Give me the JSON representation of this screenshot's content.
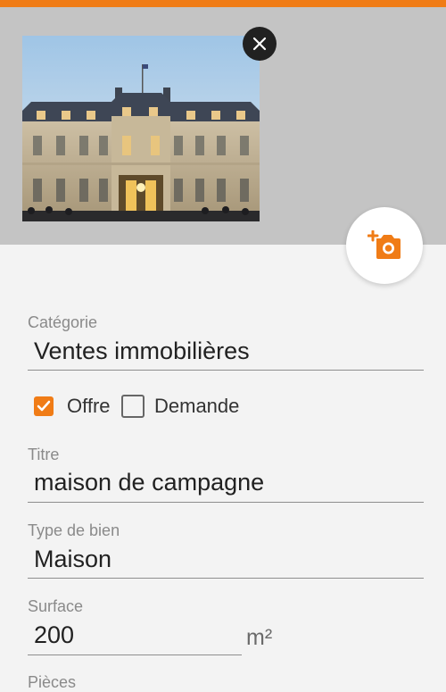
{
  "colors": {
    "accent": "#f07c16",
    "photo_background": "#c4c4c4",
    "form_background": "#f3f3f3"
  },
  "photo": {
    "remove_icon": "close-icon",
    "add_icon": "add-photo-camera-icon"
  },
  "form": {
    "category": {
      "label": "Catégorie",
      "value": "Ventes immobilières"
    },
    "offer_type": {
      "options": [
        {
          "label": "Offre",
          "checked": true
        },
        {
          "label": "Demande",
          "checked": false
        }
      ]
    },
    "title": {
      "label": "Titre",
      "value": "maison de campagne"
    },
    "property_type": {
      "label": "Type de bien",
      "value": "Maison"
    },
    "surface": {
      "label": "Surface",
      "value": "200",
      "unit": "m²"
    },
    "rooms": {
      "label": "Pièces"
    }
  }
}
